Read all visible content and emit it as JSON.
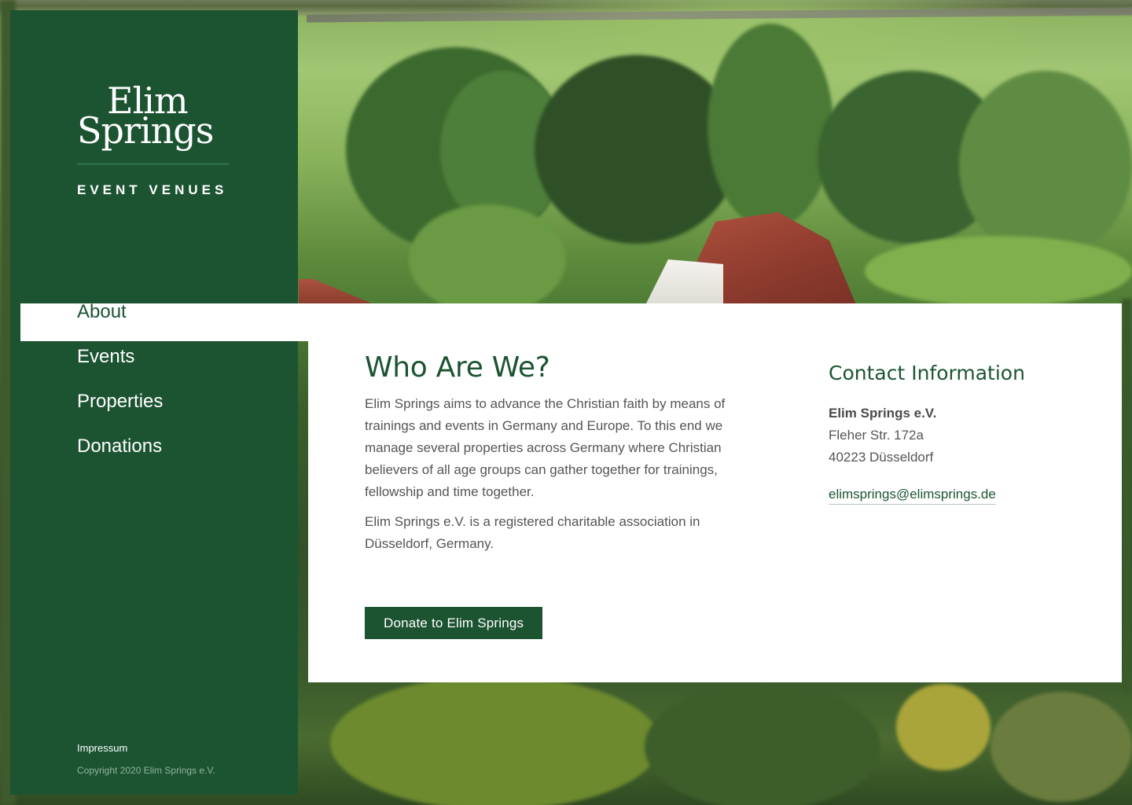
{
  "brand": {
    "name_line1": "Elim",
    "name_line2": "Springs",
    "tagline": "EVENT VENUES"
  },
  "nav": {
    "items": [
      {
        "label": "About",
        "active": true
      },
      {
        "label": "Events",
        "active": false
      },
      {
        "label": "Properties",
        "active": false
      },
      {
        "label": "Donations",
        "active": false
      }
    ]
  },
  "footer": {
    "impressum": "Impressum",
    "copyright": "Copyright 2020 Elim Springs e.V."
  },
  "about": {
    "title": "Who Are We?",
    "paragraph1": "Elim Springs aims to advance the Christian faith by means of trainings and events in Germany and Europe. To this end we manage several properties across Germany where Christian believers of all age groups can gather together for trainings, fellowship and time together.",
    "paragraph2": "Elim Springs e.V. is a registered charitable association in Düsseldorf, Germany.",
    "donate_label": "Donate to Elim Springs"
  },
  "contact": {
    "title": "Contact Information",
    "organization": "Elim Springs e.V.",
    "street": "Fleher Str. 172a",
    "city": "40223 Düsseldorf",
    "email": "elimsprings@elimsprings.de"
  },
  "colors": {
    "brand_green": "#1c5432",
    "text_gray": "#555555",
    "white": "#ffffff"
  }
}
